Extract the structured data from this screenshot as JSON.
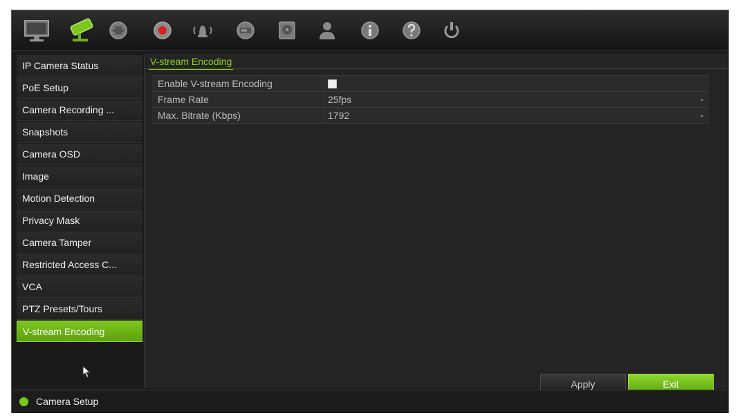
{
  "toolbar": {
    "icons": [
      "monitor-icon",
      "camera-icon",
      "network-icon",
      "record-icon",
      "alarm-icon",
      "storage-icon",
      "hdd-icon",
      "user-icon",
      "info-icon",
      "help-icon",
      "power-icon"
    ],
    "active_icon": "camera-icon"
  },
  "sidebar": {
    "items": [
      {
        "label": "IP Camera Status"
      },
      {
        "label": "PoE Setup"
      },
      {
        "label": "Camera Recording ..."
      },
      {
        "label": "Snapshots"
      },
      {
        "label": "Camera OSD"
      },
      {
        "label": "Image"
      },
      {
        "label": "Motion Detection"
      },
      {
        "label": "Privacy Mask"
      },
      {
        "label": "Camera Tamper"
      },
      {
        "label": "Restricted Access C..."
      },
      {
        "label": "VCA"
      },
      {
        "label": "PTZ Presets/Tours"
      },
      {
        "label": "V-stream Encoding"
      }
    ],
    "active_index": 12
  },
  "main": {
    "section_title": "V-stream Encoding",
    "fields": [
      {
        "label": "Enable V-stream Encoding",
        "type": "checkbox",
        "checked": false
      },
      {
        "label": "Frame Rate",
        "type": "select",
        "value": "25fps"
      },
      {
        "label": "Max. Bitrate (Kbps)",
        "type": "select",
        "value": "1792"
      }
    ],
    "apply_label": "Apply",
    "exit_label": "Exit"
  },
  "footer": {
    "label": "Camera Setup"
  },
  "colors": {
    "accent": "#7cc61f",
    "background": "#1c1c1c",
    "panel": "#242424"
  }
}
